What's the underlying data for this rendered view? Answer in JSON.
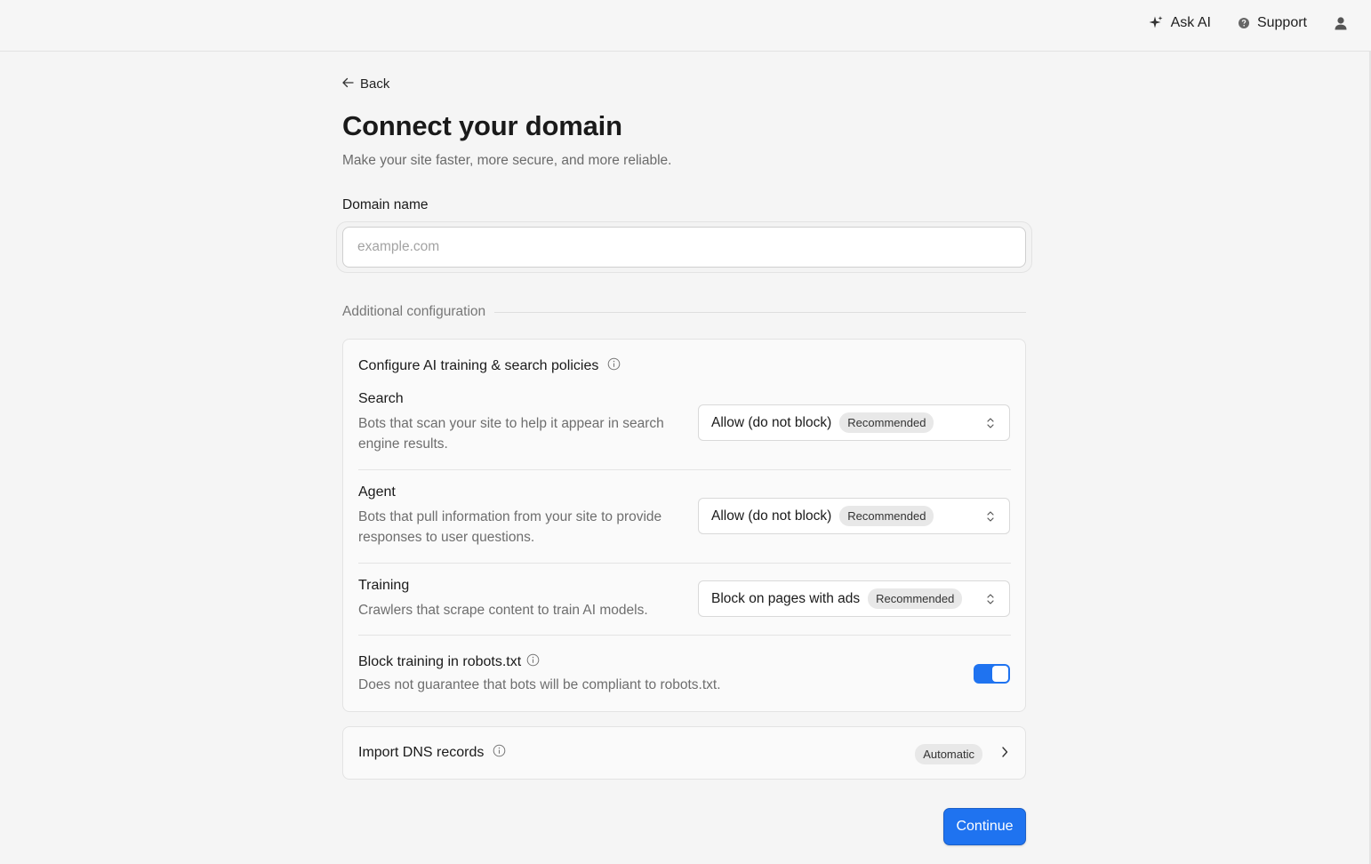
{
  "colors": {
    "accent": "#1f73f0",
    "background": "#f5f5f5",
    "muted_text": "#6e6e6e"
  },
  "topnav": {
    "ask_ai": {
      "label": "Ask AI",
      "icon": "sparkle-icon"
    },
    "support": {
      "label": "Support",
      "icon": "help-circle-icon"
    },
    "account": {
      "icon": "user-icon"
    }
  },
  "page": {
    "back_label": "Back",
    "title": "Connect your domain",
    "subtitle": "Make your site faster, more secure, and more reliable."
  },
  "domain_field": {
    "label": "Domain name",
    "placeholder": "example.com",
    "value": ""
  },
  "additional_configuration": {
    "label": "Additional configuration",
    "ai_policies": {
      "title": "Configure AI training & search policies",
      "rows": [
        {
          "title": "Search",
          "description": "Bots that scan your site to help it appear in search engine results.",
          "selected": "Allow (do not block)",
          "badge": "Recommended"
        },
        {
          "title": "Agent",
          "description": "Bots that pull information from your site to provide responses to user questions.",
          "selected": "Allow (do not block)",
          "badge": "Recommended"
        },
        {
          "title": "Training",
          "description": "Crawlers that scrape content to train AI models.",
          "selected": "Block on pages with ads",
          "badge": "Recommended"
        }
      ],
      "robots": {
        "title": "Block training in robots.txt",
        "description": "Does not guarantee that bots will be compliant to robots.txt.",
        "enabled": true
      }
    },
    "dns": {
      "title": "Import DNS records",
      "badge": "Automatic"
    }
  },
  "continue_label": "Continue"
}
